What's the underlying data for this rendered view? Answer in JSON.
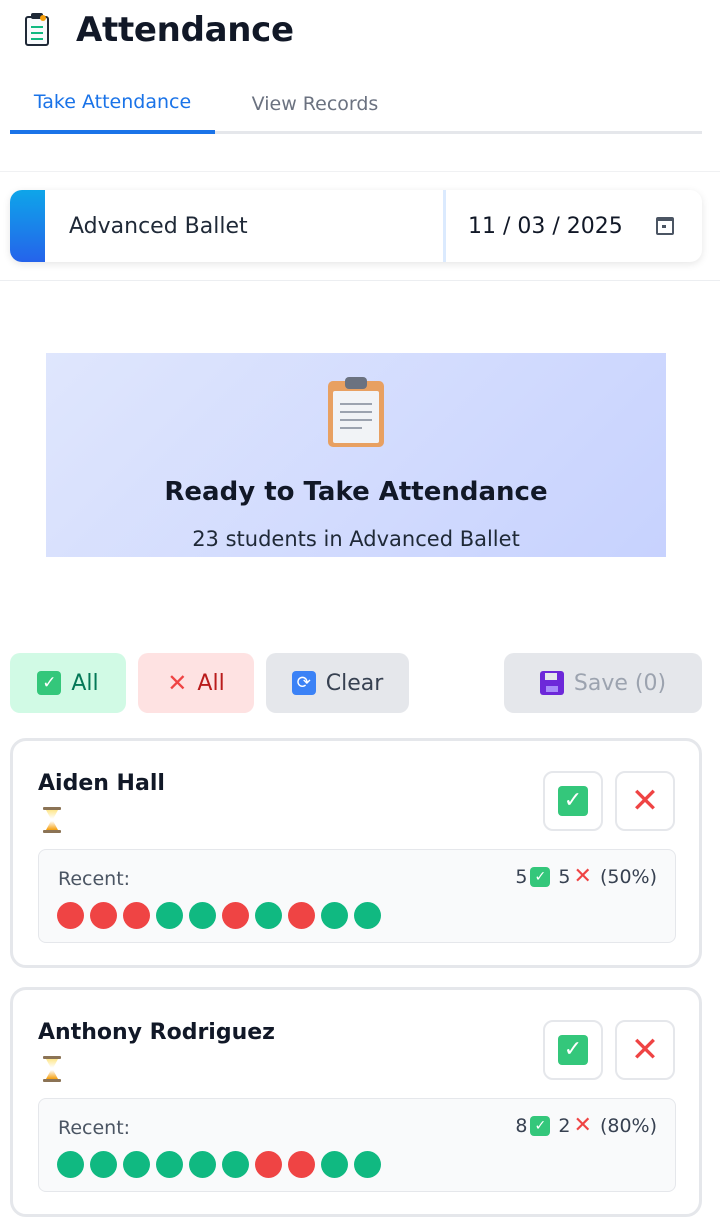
{
  "app": {
    "title": "Attendance",
    "icon": "clipboard-icon"
  },
  "tabs": [
    {
      "label": "Take Attendance",
      "active": true
    },
    {
      "label": "View Records",
      "active": false
    }
  ],
  "selector": {
    "class_name": "Advanced Ballet",
    "date": "11 / 03 / 2025"
  },
  "hero": {
    "icon": "clipboard-icon",
    "title": "Ready to Take Attendance",
    "subtitle": "23 students in Advanced Ballet"
  },
  "actions": {
    "all_present_label": "All",
    "all_absent_label": "All",
    "clear_label": "Clear",
    "save_label": "Save (0)"
  },
  "students": [
    {
      "name": "Aiden Hall",
      "status_icon": "hourglass-icon",
      "recent_label": "Recent:",
      "present_count": "5",
      "absent_count": "5",
      "percent": "(50%)",
      "history": [
        "absent",
        "absent",
        "absent",
        "present",
        "present",
        "absent",
        "present",
        "absent",
        "present",
        "present"
      ]
    },
    {
      "name": "Anthony Rodriguez",
      "status_icon": "hourglass-icon",
      "recent_label": "Recent:",
      "present_count": "8",
      "absent_count": "2",
      "percent": "(80%)",
      "history": [
        "present",
        "present",
        "present",
        "present",
        "present",
        "present",
        "absent",
        "absent",
        "present",
        "present"
      ]
    }
  ],
  "colors": {
    "accent": "#1a73e8",
    "present": "#10b981",
    "absent": "#ef4444"
  }
}
